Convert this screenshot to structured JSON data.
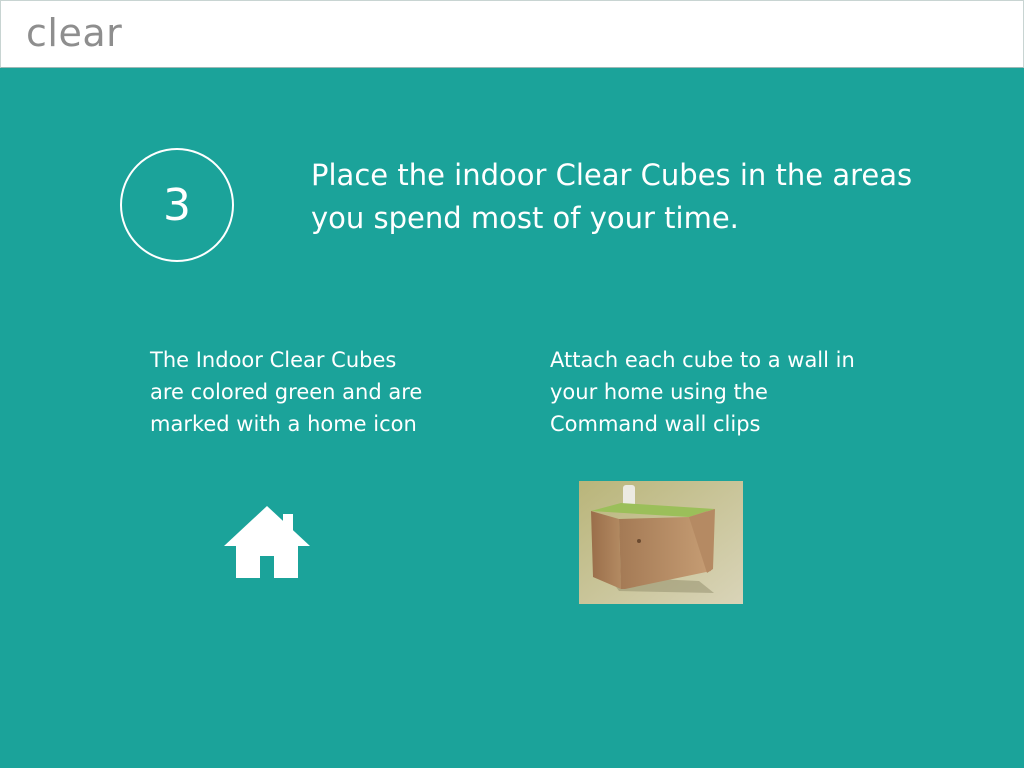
{
  "header": {
    "logo_text": "clear"
  },
  "step": {
    "number": "3",
    "headline": "Place the indoor Clear Cubes in the areas you spend most of your time."
  },
  "left_column": {
    "text": "The Indoor Clear Cubes\nare colored green and are\nmarked with a home icon",
    "icon": "home-icon"
  },
  "right_column": {
    "text": "Attach each cube to  a wall in\nyour home using the\nCommand wall clips",
    "image": "wall-mounted-cube-photo"
  },
  "colors": {
    "background": "#1ba39a",
    "header_bg": "#ffffff",
    "logo": "#8e8e8e",
    "text": "#ffffff"
  }
}
